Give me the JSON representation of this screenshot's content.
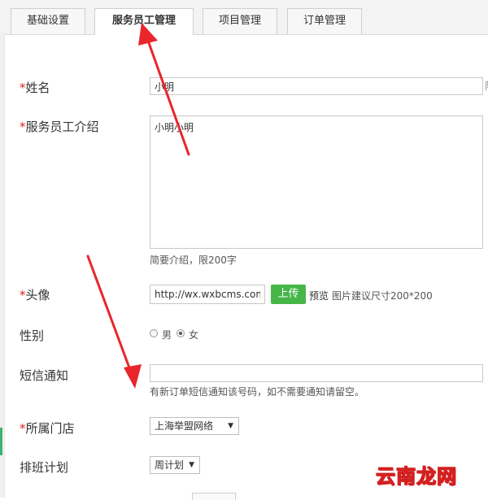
{
  "tabs": [
    {
      "label": "基础设置"
    },
    {
      "label": "服务员工管理"
    },
    {
      "label": "项目管理"
    },
    {
      "label": "订单管理"
    }
  ],
  "form": {
    "name": {
      "required_mark": "*",
      "label": "姓名",
      "value": "小明",
      "overflow_char": "限"
    },
    "intro": {
      "required_mark": "*",
      "label": "服务员工介绍",
      "value": "小明小明",
      "hint": "简要介绍，限200字"
    },
    "avatar": {
      "required_mark": "*",
      "label": "头像",
      "value": "http://wx.wxbcms.com/",
      "upload_label": "上传",
      "preview_label": "预览",
      "hint": "图片建议尺寸200*200"
    },
    "gender": {
      "label": "性别",
      "options": [
        "男",
        "女"
      ],
      "selected": "女"
    },
    "sms": {
      "label": "短信通知",
      "value": "",
      "hint": "有新订单短信通知该号码，如不需要通知请留空。"
    },
    "store": {
      "required_mark": "*",
      "label": "所属门店",
      "selected": "上海举盟网络"
    },
    "schedule": {
      "label": "排班计划",
      "selected": "周计划"
    }
  },
  "watermark": "云南龙网",
  "colors": {
    "required": "#e02020",
    "upload_button": "#47b649",
    "annotation_arrow": "#e8262b"
  }
}
